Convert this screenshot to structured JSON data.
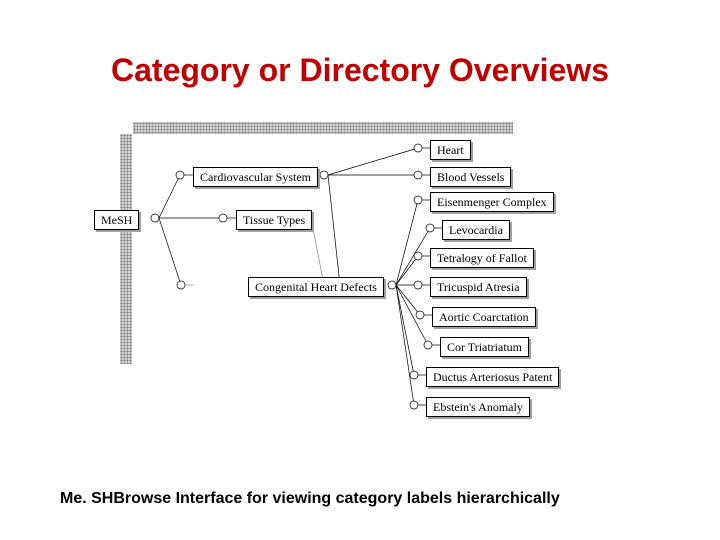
{
  "title": "Category or Directory Overviews",
  "caption": "Me. SHBrowse Interface for viewing category labels hierarchically",
  "nodes": {
    "mesh": "MeSH",
    "cardiovascular": "Cardiovascular System",
    "tissue_types": "Tissue Types",
    "congenital": "Congenital Heart Defects",
    "heart": "Heart",
    "blood_vessels": "Blood Vessels",
    "eisenmenger": "Eisenmenger Complex",
    "levocardia": "Levocardia",
    "tetralogy": "Tetralogy of Fallot",
    "tricuspid": "Tricuspid Atresia",
    "aortic": "Aortic Coarctation",
    "cor": "Cor Triatriatum",
    "ductus": "Ductus Arteriosus Patent",
    "ebstein": "Ebstein's Anomaly"
  }
}
